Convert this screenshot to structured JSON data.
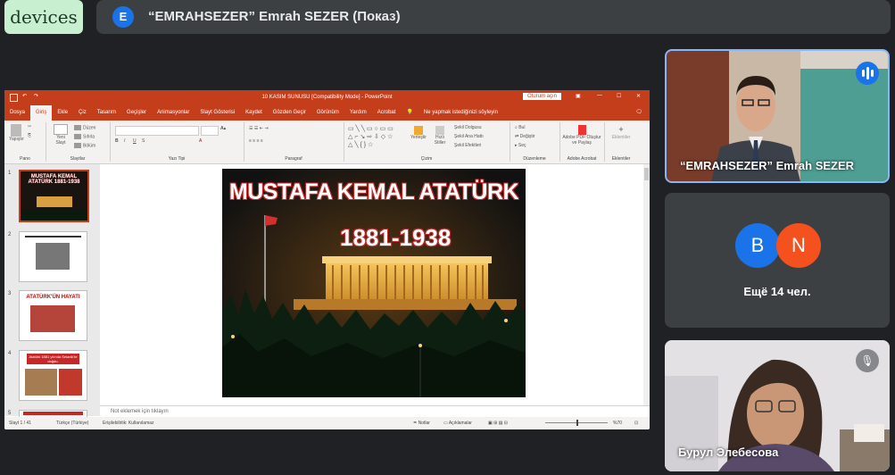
{
  "top": {
    "devices_label": "devices",
    "presenter_initial": "E",
    "presenter_text": "“EMRAHSEZER” Emrah SEZER (Показ)"
  },
  "ppt": {
    "title": "10 KASIM SUNUSU [Compatibility Mode] - PowerPoint",
    "signin": "Oturum açın",
    "tabs": [
      "Dosya",
      "Giriş",
      "Ekle",
      "Çiz",
      "Tasarım",
      "Geçişler",
      "Animasyonlar",
      "Slayt Gösterisi",
      "Kaydet",
      "Gözden Geçir",
      "Görünüm",
      "Yardım",
      "Acrobat"
    ],
    "tell_me": "Ne yapmak istediğinizi söyleyin",
    "ribbon": {
      "groups": [
        "Pano",
        "Slaytlar",
        "Yazı Tipi",
        "Paragraf",
        "Çizim",
        "Düzenleme",
        "Adobe Acrobat",
        "Eklentiler"
      ],
      "paste": "Yapıştır",
      "new_slide": "Yeni Slayt",
      "layout": "Düzen",
      "reset": "Sıfırla",
      "section": "Bölüm",
      "arrange": "Yerleştir",
      "quick_styles": "Hızlı Stiller",
      "shape_fill": "Şekil Dolgusu",
      "shape_outline": "Şekil Ana Hattı",
      "shape_effects": "Şekil Efektleri",
      "find": "Bul",
      "replace": "Değiştir",
      "select": "Seç",
      "adobe": "Adobe PDF Oluştur ve Paylaş",
      "addins": "Eklentiler"
    },
    "thumbnails": [
      {
        "num": "1",
        "text": "MUSTAFA KEMAL ATATÜRK 1881-1938"
      },
      {
        "num": "2",
        "text": ""
      },
      {
        "num": "3",
        "text": "ATATÜRK'ÜN HAYATI"
      },
      {
        "num": "4",
        "text": "Atatürk 1881 yılında Selanik'te doğdu."
      },
      {
        "num": "5",
        "text": ""
      }
    ],
    "slide": {
      "title": "MUSTAFA KEMAL ATATÜRK",
      "years": "1881-1938"
    },
    "notes_placeholder": "Not eklemek için tıklayın",
    "status": {
      "slide_counter": "Slayt 1 / 41",
      "language": "Türkçe (Türkiye)",
      "accessibility": "Erişilebilirlik: Kullanılamaz",
      "notes_btn": "Notlar",
      "comments_btn": "Açıklamalar",
      "zoom": "%70"
    }
  },
  "participants": {
    "tile1_name": "“EMRAHSEZER” Emrah SEZER",
    "avatar_b": "B",
    "avatar_n": "N",
    "more": "Ещё 14 чел.",
    "tile3_name": "Бурул Элебесова"
  },
  "colors": {
    "avatar_b": "#1a73e8",
    "avatar_n": "#f4511e",
    "ppt_accent": "#c43e1c",
    "active_tile_border": "#8ab4f8"
  }
}
